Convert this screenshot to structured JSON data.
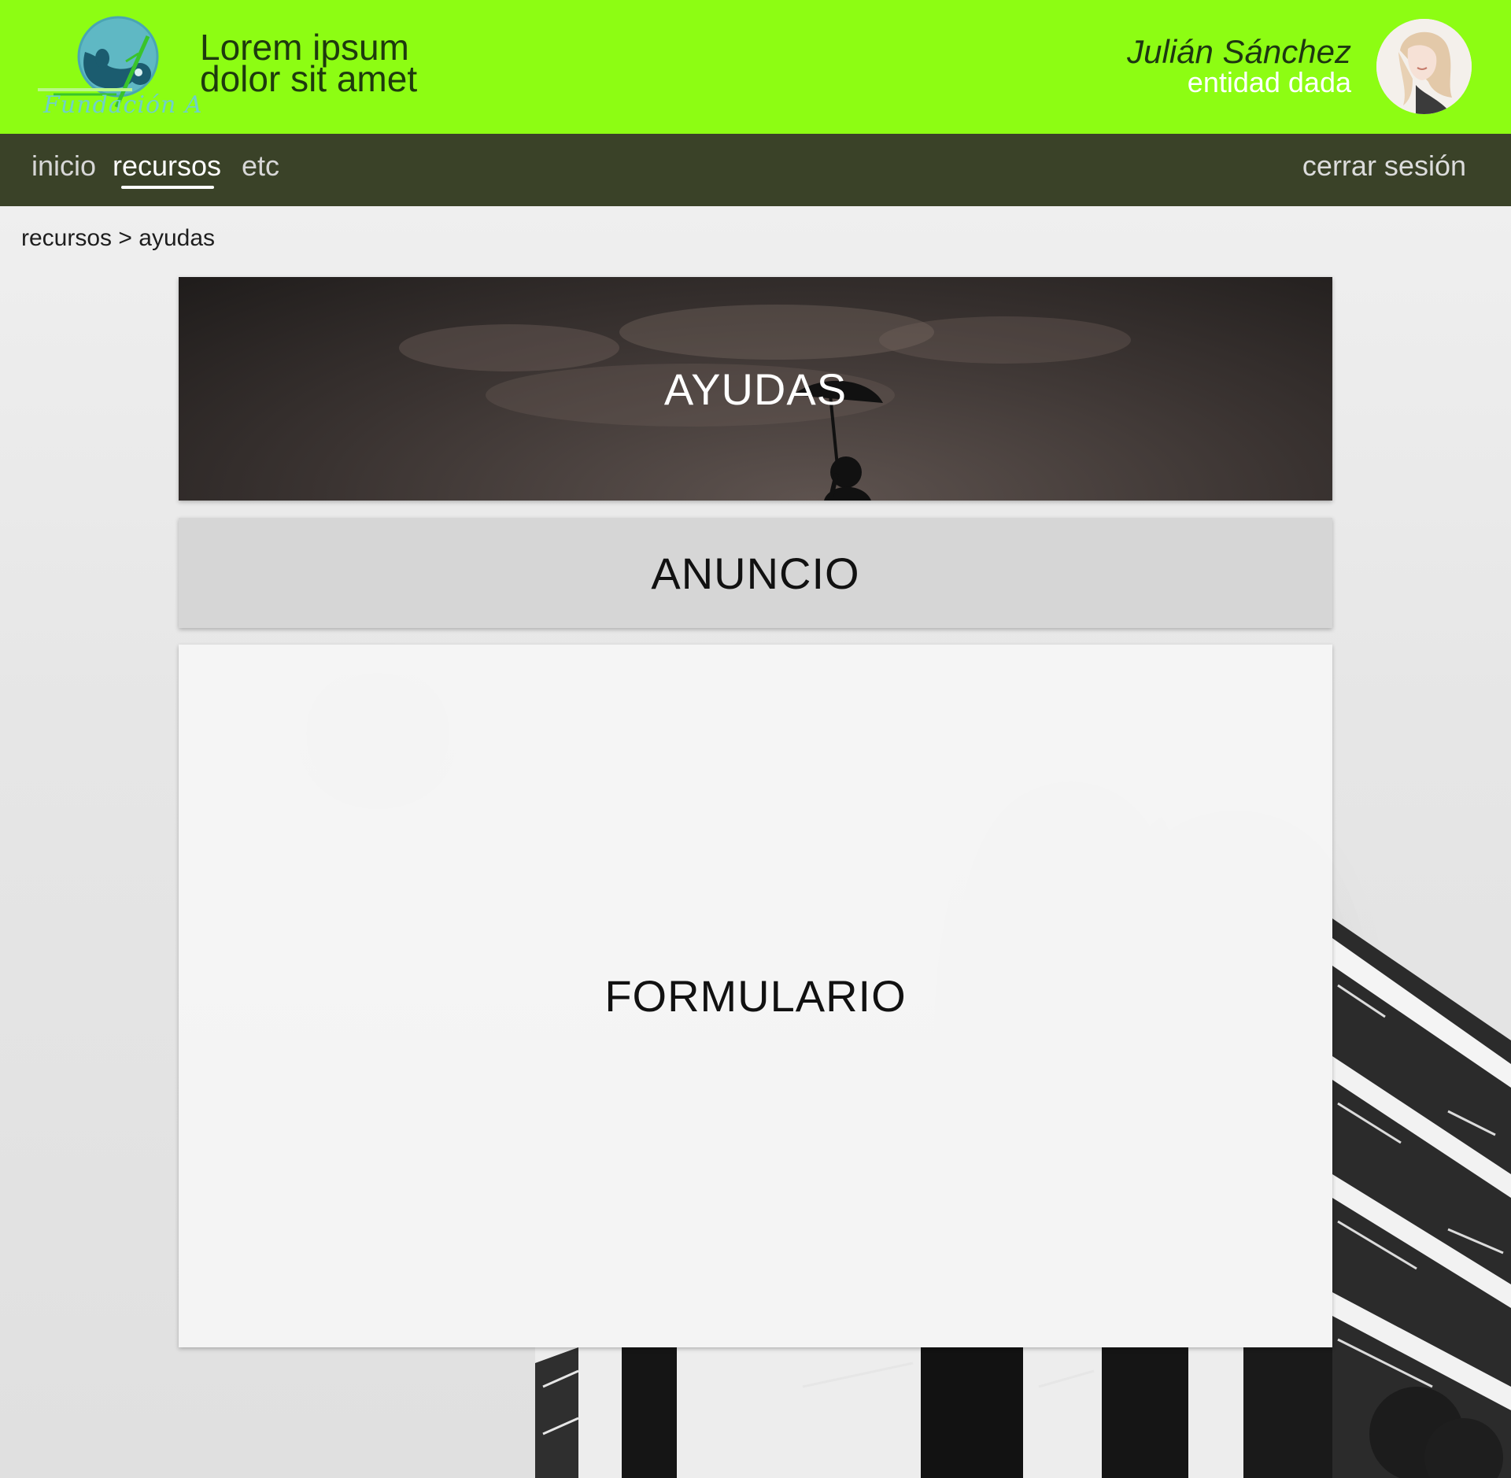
{
  "header": {
    "logo_text": "Fundación A",
    "title_line1": "Lorem ipsum",
    "title_line2": "dolor sit amet",
    "user_name": "Julián Sánchez",
    "user_entity": "entidad dada"
  },
  "nav": {
    "items": [
      {
        "label": "inicio",
        "active": false
      },
      {
        "label": "recursos",
        "active": true
      },
      {
        "label": "etc",
        "active": false
      }
    ],
    "logout": "cerrar sesión"
  },
  "breadcrumb": {
    "parent": "recursos",
    "separator": ">",
    "current": "ayudas"
  },
  "cards": {
    "hero": "AYUDAS",
    "ad": "ANUNCIO",
    "form": "FORMULARIO"
  },
  "colors": {
    "header_bg": "#8dfd13",
    "nav_bg": "#3a4228",
    "accent_text": "#1e3a0e"
  }
}
